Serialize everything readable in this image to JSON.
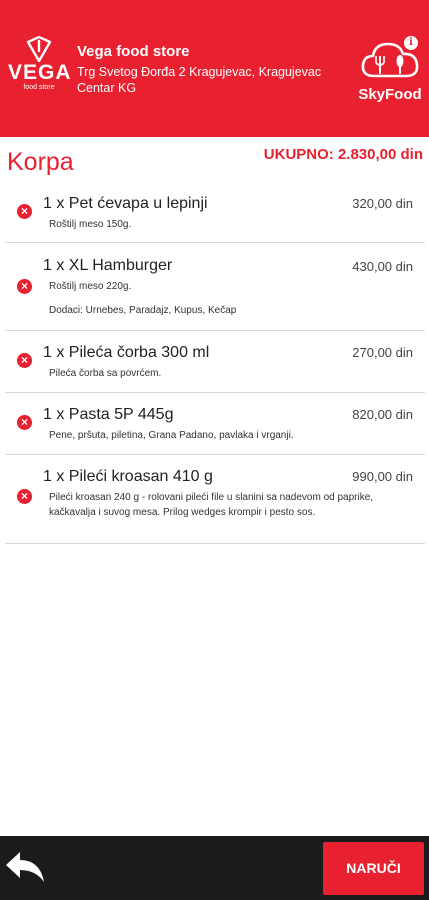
{
  "header": {
    "store_name": "Vega food store",
    "store_address_line1": "Trg Svetog Đorđa 2 Kragujevac, Kragujevac",
    "store_address_line2": "Centar KG",
    "vega_logo_text": "VEGA",
    "vega_logo_sub": "food store",
    "skyfood_logo_text": "SkyFood",
    "info_icon_text": "i"
  },
  "cart": {
    "title": "Korpa",
    "total_label": "UKUPNO: 2.830,00 din",
    "items": [
      {
        "name": "1 x Pet ćevapa u lepinji",
        "price": "320,00 din",
        "desc": [
          "Roštilj meso 150g."
        ]
      },
      {
        "name": "1 x XL Hamburger",
        "price": "430,00 din",
        "desc": [
          "Roštilj meso 220g.",
          "Dodaci: Urnebes, Paradajz, Kupus, Kečap"
        ]
      },
      {
        "name": "1 x Pileća čorba 300 ml",
        "price": "270,00 din",
        "desc": [
          "Pileća čorba sa povrćem."
        ]
      },
      {
        "name": "1 x Pasta 5P 445g",
        "price": "820,00 din",
        "desc": [
          "Pene, pršuta, piletina, Grana Padano, pavlaka i vrganji."
        ]
      },
      {
        "name": "1 x Pileći kroasan 410 g",
        "price": "990,00 din",
        "desc": [
          "Pileći kroasan 240 g - rolovani pileći file u slanini sa nadevom od paprike,",
          "kačkavalja i suvog mesa. Prilog wedges krompir i pesto sos."
        ]
      }
    ]
  },
  "footer": {
    "order_button": "NARUČI"
  },
  "colors": {
    "brand_red": "#e8202f",
    "footer_dark": "#1b1b1b"
  }
}
